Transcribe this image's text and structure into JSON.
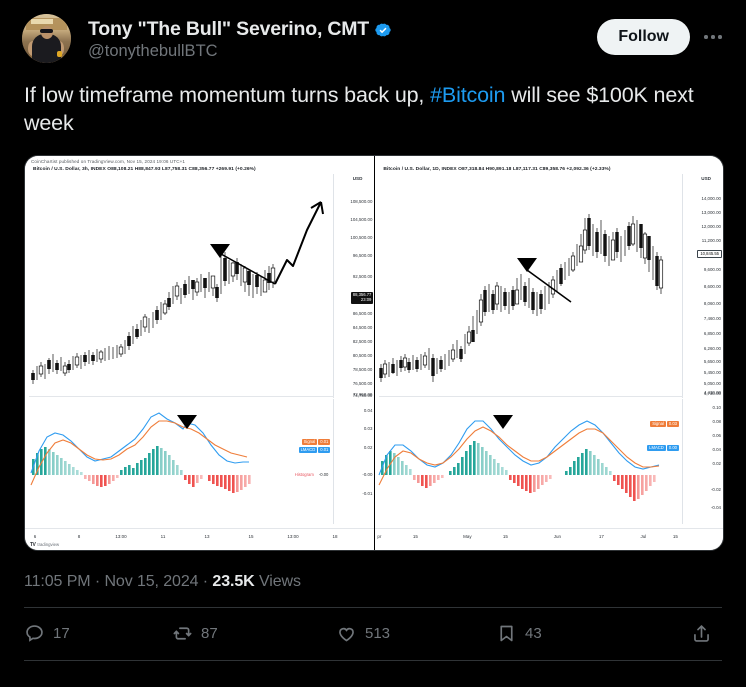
{
  "post": {
    "author_name": "Tony \"The Bull\" Severino, CMT",
    "author_handle": "@tonythebullBTC",
    "verified_badge": "verified-badge-icon",
    "follow_label": "Follow",
    "more_label": "more-options-icon",
    "text_before_link": "If low timeframe momentum turns back up, ",
    "link_text": "#Bitcoin",
    "text_after_link": " will see $100K next week",
    "timestamp": "11:05 PM",
    "date": "Nov 15, 2024",
    "views_count": "23.5K",
    "views_label": "Views",
    "separator": "·"
  },
  "actions": [
    {
      "name": "reply",
      "icon": "comment-icon",
      "count": "17"
    },
    {
      "name": "repost",
      "icon": "repost-icon",
      "count": "87"
    },
    {
      "name": "like",
      "icon": "heart-icon",
      "count": "513"
    },
    {
      "name": "bookmark",
      "icon": "bookmark-icon",
      "count": "43"
    },
    {
      "name": "share",
      "icon": "share-icon",
      "count": ""
    }
  ],
  "colors": {
    "background": "#000000",
    "text": "#e7e9ea",
    "muted": "#71767b",
    "link": "#1d9bf0",
    "verified": "#1d9bf0",
    "follow_bg": "#eff3f4",
    "card_border": "#2f3336",
    "chart_bg": "#ffffff",
    "macd_line": "#2f9cf0",
    "signal_line": "#ef7d3a",
    "hist_up": "#26a69a",
    "hist_down": "#ef5350"
  },
  "chart_data": [
    {
      "type": "line",
      "panel": "left-price",
      "title": "Bitcoin / U.S. Dollar, 3h, INDEX",
      "watermark": "CoinChartist published on TradingView.com, Nov 15, 2024 19:06 UTC+1",
      "ohlc": "O88,108.21  H88,847.93  L87,758.31  C88,356.77 +269.91 (+0.26%)",
      "symbol": "Bitcoin / U.S. Dollar",
      "interval": "3h",
      "exchange": "INDEX",
      "open": "88,108.21",
      "high": "88,847.93",
      "low": "87,758.31",
      "close": "88,356.77",
      "change": "+269.91",
      "change_pct": "(+0.26%)",
      "price_unit": "USD",
      "current_price": "88,356.77",
      "current_time": "23:09",
      "ytick_labels": [
        "108,500.00",
        "104,500.00",
        "100,500.00",
        "96,500.00",
        "92,500.00",
        "86,500.00",
        "84,500.00",
        "82,500.00",
        "80,500.00",
        "78,500.00",
        "76,500.00",
        "74,750.00",
        "72,950.00"
      ],
      "xtick_labels": [
        "6",
        "8",
        "13:00",
        "11",
        "13",
        "15",
        "13:00",
        "18"
      ],
      "annotations": [
        "black-down-triangle-marker",
        "descending-trendline",
        "hand-drawn-up-arrow-projection"
      ],
      "grid": false,
      "legend": "none"
    },
    {
      "type": "line",
      "panel": "right-price",
      "title": "Bitcoin / U.S. Dollar, 1D, INDEX",
      "ohlc": "O87,318.84  H90,891.18  L87,117.31  C89,358.76 +2,092.36 (+2.33%)",
      "symbol": "Bitcoin / U.S. Dollar",
      "interval": "1D",
      "exchange": "INDEX",
      "open": "87,318.84",
      "high": "90,891.18",
      "low": "87,117.31",
      "close": "89,358.76",
      "change": "+2,092.36",
      "change_pct": "(+2.33%)",
      "price_unit": "USD",
      "current_price": "10,845.55",
      "ytick_labels": [
        "14,000.00",
        "13,000.00",
        "12,000.00",
        "11,200.00",
        "9,600.00",
        "8,600.00",
        "8,060.00",
        "7,460.00",
        "6,850.00",
        "6,260.00",
        "5,650.00",
        "5,450.00",
        "5,050.00",
        "4,730.00",
        "4,430.00"
      ],
      "xtick_labels": [
        "15",
        "May",
        "15",
        "Jun",
        "17",
        "Jul",
        "15"
      ],
      "annotations": [
        "black-down-triangle-marker",
        "descending-trendline"
      ],
      "grid": false,
      "legend": "none"
    },
    {
      "type": "bar",
      "panel": "left-macd",
      "indicator": "MACD",
      "series": [
        {
          "name": "Signal",
          "value": "0.01",
          "color": "#ef7d3a"
        },
        {
          "name": "LMACD",
          "value": "0.01",
          "color": "#2f9cf0"
        },
        {
          "name": "Histogram",
          "value": "-0.00",
          "color": "#e8555f"
        }
      ],
      "ytick_labels": [
        "0.04",
        "0.03",
        "0.02",
        "-0.00",
        "-0.01"
      ],
      "annotations": [
        "black-down-triangle-marker"
      ]
    },
    {
      "type": "bar",
      "panel": "right-macd",
      "indicator": "MACD",
      "series": [
        {
          "name": "Signal",
          "value": "0.03",
          "color": "#ef7d3a"
        },
        {
          "name": "LMACD",
          "value": "0.00",
          "color": "#2f9cf0"
        }
      ],
      "ytick_labels": [
        "0.10",
        "0.08",
        "0.06",
        "0.04",
        "0.02",
        "-0.02",
        "-0.04"
      ],
      "annotations": [
        "black-down-triangle-marker"
      ]
    }
  ],
  "tradingview_label": "tradingview"
}
